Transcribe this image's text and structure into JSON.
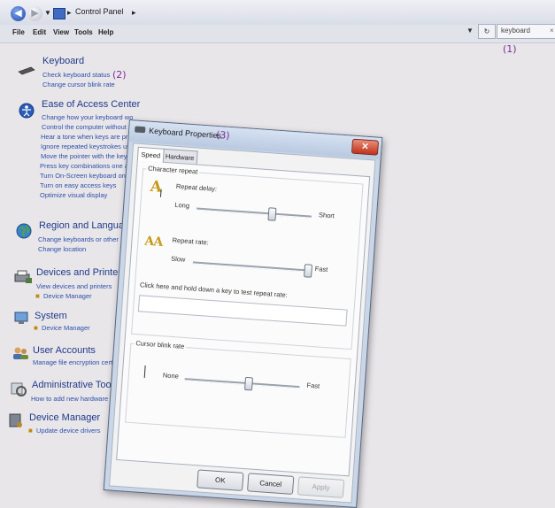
{
  "address_bar": {
    "breadcrumb": "Control Panel",
    "search_value": "keyboard"
  },
  "menu": [
    "File",
    "Edit",
    "View",
    "Tools",
    "Help"
  ],
  "annotations": {
    "one": "(1)",
    "two": "(2)",
    "three": "(3)"
  },
  "categories": [
    {
      "title": "Keyboard",
      "icon": "keyboard-icon",
      "links": [
        "Check keyboard status",
        "Change cursor blink rate"
      ]
    },
    {
      "title": "Ease of Access Center",
      "icon": "ease-of-access-icon",
      "links": [
        "Change how your keyboard wo",
        "Control the computer without",
        "Hear a tone when keys are pres",
        "Ignore repeated keystrokes usi",
        "Move the pointer with the keyp",
        "Press key combinations one at",
        "Turn On-Screen keyboard on o",
        "Turn on easy access keys",
        "Optimize visual display"
      ]
    },
    {
      "title": "Region and Language",
      "icon": "globe-icon",
      "links": [
        "Change keyboards or other inp",
        "Change location"
      ]
    },
    {
      "title": "Devices and Printers",
      "icon": "printer-icon",
      "links": [
        "View devices and printers",
        "Device Manager"
      ]
    },
    {
      "title": "System",
      "icon": "computer-icon",
      "links": [
        "Device Manager"
      ]
    },
    {
      "title": "User Accounts",
      "icon": "users-icon",
      "links": [
        "Manage file encryption certific"
      ]
    },
    {
      "title": "Administrative Tools",
      "icon": "admin-tools-icon",
      "links": [
        "How to add new hardware"
      ]
    },
    {
      "title": "Device Manager",
      "icon": "device-manager-icon",
      "links": [
        "Update device drivers"
      ]
    }
  ],
  "dialog": {
    "title": "Keyboard Properties",
    "tabs": [
      "Speed",
      "Hardware"
    ],
    "character_repeat": {
      "label": "Character repeat",
      "repeat_delay": {
        "label": "Repeat delay:",
        "min_label": "Long",
        "max_label": "Short",
        "level": 0.65
      },
      "repeat_rate": {
        "label": "Repeat rate:",
        "min_label": "Slow",
        "max_label": "Fast",
        "level": 1.0
      },
      "test_label": "Click here and hold down a key to test repeat rate:"
    },
    "cursor_blink": {
      "label": "Cursor blink rate",
      "min_label": "None",
      "max_label": "Fast",
      "level": 0.55
    },
    "buttons": {
      "ok": "OK",
      "cancel": "Cancel",
      "apply": "Apply"
    },
    "colors": {
      "close_button": "#c0321d",
      "accent": "#c79a16"
    }
  }
}
